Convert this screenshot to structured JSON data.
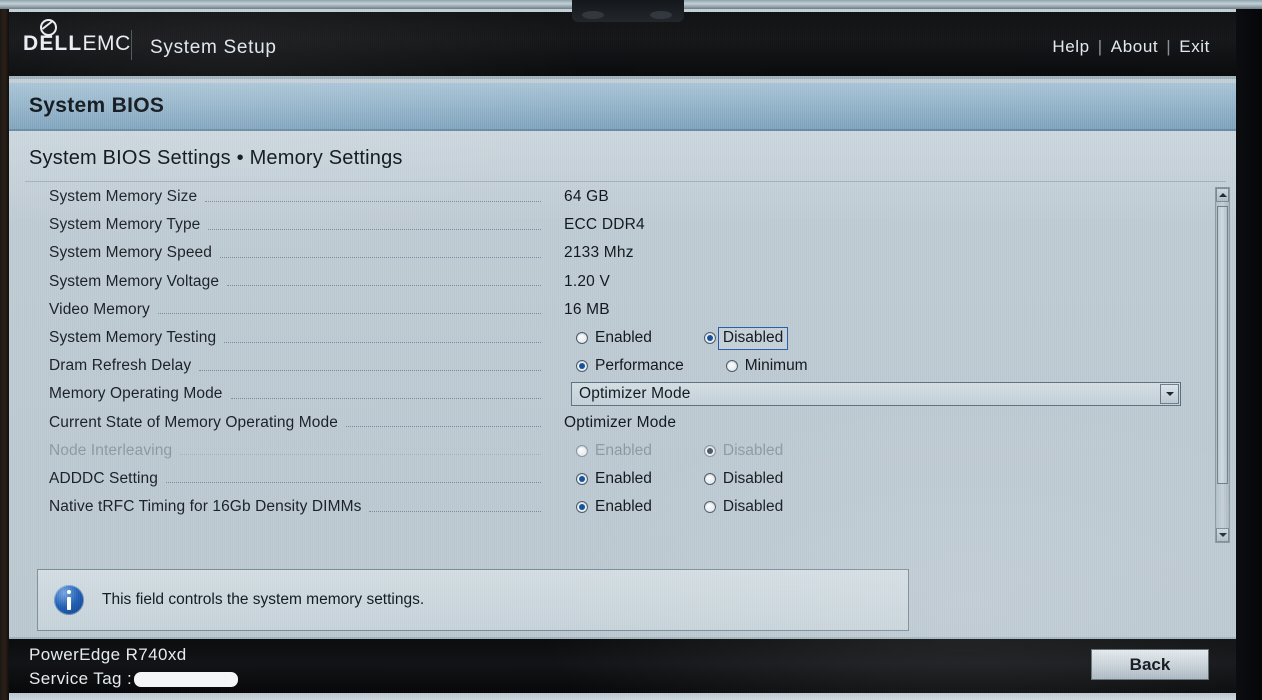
{
  "topbar": {
    "brand_dell": "DELL",
    "brand_emc": "EMC",
    "app_title": "System Setup",
    "nav": {
      "help": "Help",
      "sep1": "|",
      "about": "About",
      "sep2": "|",
      "exit": "Exit"
    }
  },
  "page": {
    "header": "System BIOS",
    "breadcrumb": "System BIOS Settings • Memory Settings"
  },
  "settings": [
    {
      "label": "System Memory Size",
      "type": "readonly",
      "value": "64 GB"
    },
    {
      "label": "System Memory Type",
      "type": "readonly",
      "value": "ECC DDR4"
    },
    {
      "label": "System Memory Speed",
      "type": "readonly",
      "value": "2133 Mhz"
    },
    {
      "label": "System Memory Voltage",
      "type": "readonly",
      "value": "1.20 V"
    },
    {
      "label": "Video Memory",
      "type": "readonly",
      "value": "16 MB"
    },
    {
      "label": "System Memory Testing",
      "type": "radio",
      "options": [
        "Enabled",
        "Disabled"
      ],
      "selected": "Disabled",
      "focused": "Disabled",
      "dimmed": false
    },
    {
      "label": "Dram Refresh Delay",
      "type": "radio",
      "options": [
        "Performance",
        "Minimum"
      ],
      "selected": "Performance",
      "focused": null,
      "dimmed": false
    },
    {
      "label": "Memory Operating Mode",
      "type": "dropdown",
      "value": "Optimizer Mode",
      "options": [
        "Optimizer Mode"
      ]
    },
    {
      "label": "Current State of Memory Operating Mode",
      "type": "readonly",
      "value": "Optimizer Mode"
    },
    {
      "label": "Node Interleaving",
      "type": "radio",
      "options": [
        "Enabled",
        "Disabled"
      ],
      "selected": "Disabled",
      "focused": null,
      "dimmed": true
    },
    {
      "label": "ADDDC Setting",
      "type": "radio",
      "options": [
        "Enabled",
        "Disabled"
      ],
      "selected": "Enabled",
      "focused": null,
      "dimmed": false
    },
    {
      "label": "Native tRFC Timing for 16Gb Density DIMMs",
      "type": "radio",
      "options": [
        "Enabled",
        "Disabled"
      ],
      "selected": "Enabled",
      "focused": null,
      "dimmed": false
    }
  ],
  "help": {
    "icon": "info-icon",
    "text": "This field controls the system memory settings."
  },
  "footer": {
    "model": "PowerEdge R740xd",
    "service_tag_label": "Service Tag :",
    "service_tag_value": "",
    "back_label": "Back"
  },
  "scrollbar": {
    "up_icon": "chevron-up-icon",
    "down_icon": "chevron-down-icon"
  },
  "colors": {
    "accent_blue": "#14529e",
    "header_band": "#93b3c9",
    "content_bg": "#bfcbd3",
    "topbar_bg": "#16171a",
    "dim_text": "#8e9aa3"
  }
}
